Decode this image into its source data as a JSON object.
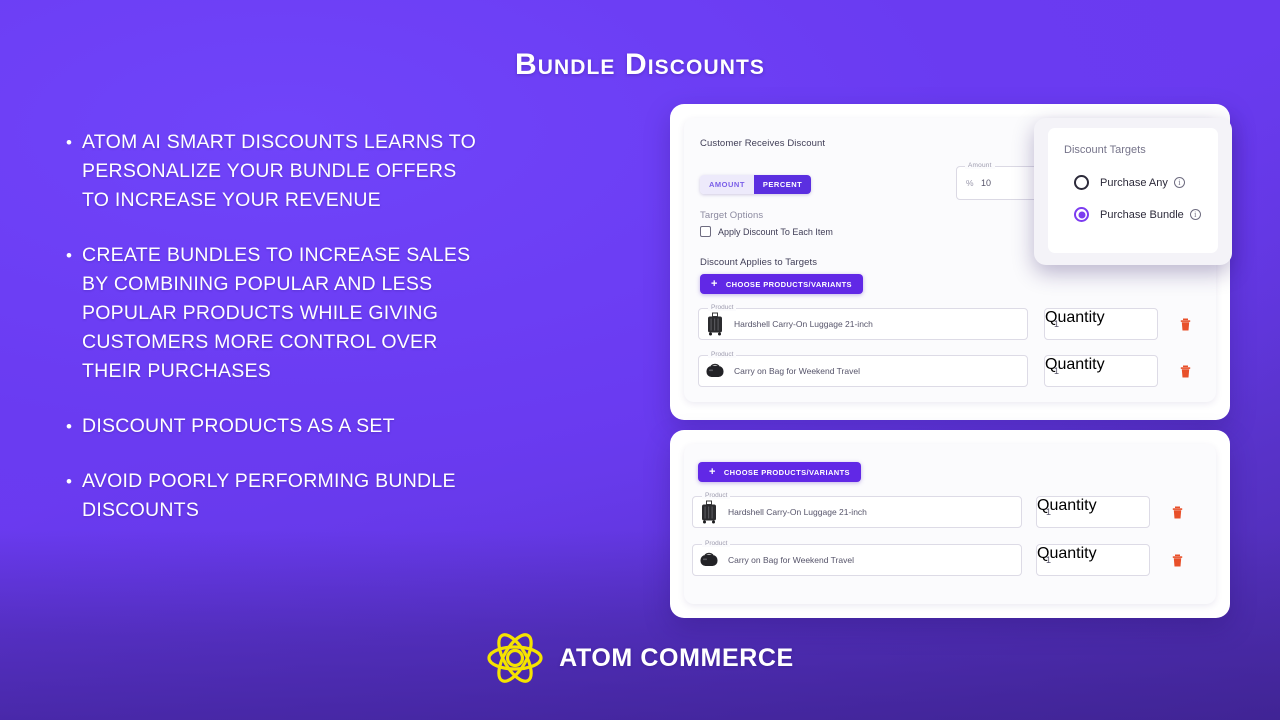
{
  "slide": {
    "title": "Bundle Discounts",
    "background_color": "#6B3BF2",
    "accent_color": "#6128E6",
    "logo_color": "#F5E300"
  },
  "bullets": [
    {
      "text": "Atom AI Smart Discounts learns to personalize your bundle offers to increase your revenue"
    },
    {
      "text": "Create bundles to increase sales by combining popular and less popular products while giving customers more control over their purchases"
    },
    {
      "text": "Discount products as a set"
    },
    {
      "text": "Avoid poorly performing bundle discounts"
    }
  ],
  "card_top": {
    "customer_receives_label": "Customer Receives Discount",
    "segmented": {
      "amount": "AMOUNT",
      "percent": "PERCENT",
      "selected": "PERCENT"
    },
    "amount_field": {
      "legend": "Amount",
      "prefix": "%",
      "value": "10"
    },
    "target_options_label": "Target Options",
    "apply_each_item": {
      "label": "Apply Discount To Each Item",
      "checked": false
    },
    "applies_to_label": "Discount Applies to Targets",
    "choose_button": "CHOOSE PRODUCTS/VARIANTS",
    "product_legend": "Product",
    "quantity_legend": "Quantity",
    "rows": [
      {
        "product": "Hardshell Carry-On Luggage 21-inch",
        "quantity": "1",
        "thumb": "suitcase-icon"
      },
      {
        "product": "Carry on Bag for Weekend Travel",
        "quantity": "1",
        "thumb": "duffel-bag-icon"
      }
    ]
  },
  "targets_popover": {
    "title": "Discount Targets",
    "options": [
      {
        "label": "Purchase Any",
        "selected": false,
        "info": "i"
      },
      {
        "label": "Purchase Bundle",
        "selected": true,
        "info": "i"
      }
    ]
  },
  "card_bottom": {
    "choose_button": "CHOOSE PRODUCTS/VARIANTS",
    "product_legend": "Product",
    "quantity_legend": "Quantity",
    "rows": [
      {
        "product": "Hardshell Carry-On Luggage 21-inch",
        "quantity": "1",
        "thumb": "suitcase-icon"
      },
      {
        "product": "Carry on Bag for Weekend Travel",
        "quantity": "1",
        "thumb": "duffel-bag-icon"
      }
    ]
  },
  "footer": {
    "brand": "ATOM COMMERCE",
    "logo_icon": "atom-icon"
  }
}
